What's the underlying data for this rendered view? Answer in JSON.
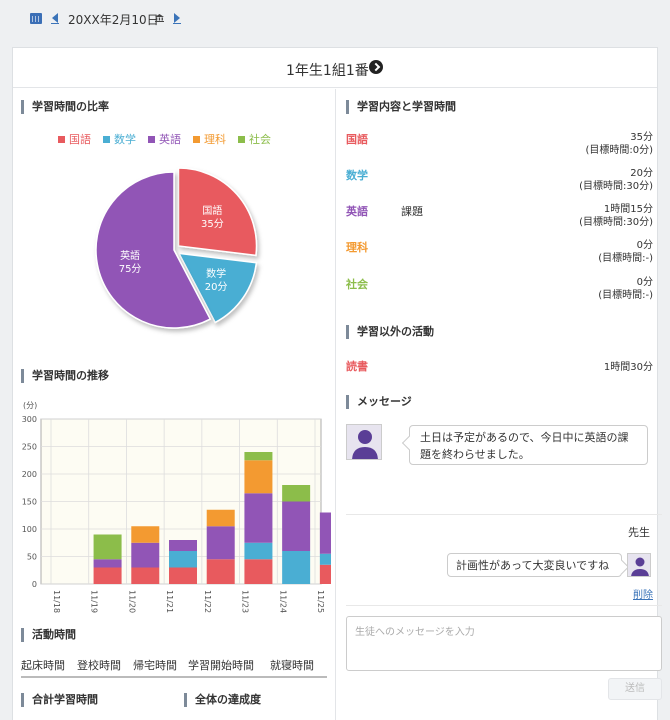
{
  "nav": {
    "date": "20XX年2月10日",
    "cal_icon": "calendar-icon",
    "prev_icon": "caret-left-icon",
    "next_icon": "caret-right-icon",
    "date_icon": "bank-icon"
  },
  "student": {
    "name": "1年生1組1番"
  },
  "colors": {
    "japanese": "#e85a5e",
    "math": "#4aaed3",
    "english": "#9155b6",
    "science": "#f39a31",
    "social": "#8cbd4a",
    "accent": "#3b74b9",
    "section_bar": "#7d8a99"
  },
  "ratio_section": {
    "title": "学習時間の比率",
    "legend": [
      "国語",
      "数学",
      "英語",
      "理科",
      "社会"
    ],
    "pie": [
      {
        "subject": "国語",
        "label": "35分",
        "value": 35,
        "color": "#e85a5e"
      },
      {
        "subject": "数学",
        "label": "20分",
        "value": 20,
        "color": "#4aaed3"
      },
      {
        "subject": "英語",
        "label": "75分",
        "value": 75,
        "color": "#9155b6"
      }
    ]
  },
  "trend_section": {
    "title": "学習時間の推移",
    "unit": "(分)"
  },
  "chart_data": {
    "type": "bar",
    "stacked": true,
    "categories": [
      "11/18",
      "11/19",
      "11/20",
      "11/21",
      "11/22",
      "11/23",
      "11/24",
      "11/25"
    ],
    "ylim": [
      0,
      300
    ],
    "yticks": [
      0,
      50,
      100,
      150,
      200,
      250,
      300
    ],
    "ylabel": "(分)",
    "grid": true,
    "series": [
      {
        "name": "国語",
        "color": "#e85a5e",
        "values": [
          0,
          30,
          30,
          30,
          45,
          45,
          0,
          35
        ]
      },
      {
        "name": "数学",
        "color": "#4aaed3",
        "values": [
          0,
          0,
          0,
          30,
          0,
          30,
          60,
          20
        ]
      },
      {
        "name": "英語",
        "color": "#9155b6",
        "values": [
          0,
          15,
          45,
          20,
          60,
          90,
          90,
          75
        ]
      },
      {
        "name": "理科",
        "color": "#f39a31",
        "values": [
          0,
          0,
          30,
          0,
          30,
          60,
          0,
          0
        ]
      },
      {
        "name": "社会",
        "color": "#8cbd4a",
        "values": [
          0,
          45,
          0,
          0,
          0,
          15,
          30,
          0
        ]
      }
    ]
  },
  "activity_section": {
    "title": "活動時間",
    "columns": [
      "起床時間",
      "登校時間",
      "帰宅時間",
      "学習開始時間",
      "就寝時間"
    ]
  },
  "total_section": {
    "title": "合計学習時間"
  },
  "achieve_section": {
    "title": "全体の達成度"
  },
  "content_section": {
    "title": "学習内容と学習時間",
    "rows": [
      {
        "subject": "国語",
        "task": "",
        "time": "35分",
        "goal": "(目標時間:0分)",
        "color": "#e85a5e"
      },
      {
        "subject": "数学",
        "task": "",
        "time": "20分",
        "goal": "(目標時間:30分)",
        "color": "#4aaed3"
      },
      {
        "subject": "英語",
        "task": "課題",
        "time": "1時間15分",
        "goal": "(目標時間:30分)",
        "color": "#9155b6"
      },
      {
        "subject": "理科",
        "task": "",
        "time": "0分",
        "goal": "(目標時間:-)",
        "color": "#f39a31"
      },
      {
        "subject": "社会",
        "task": "",
        "time": "0分",
        "goal": "(目標時間:-)",
        "color": "#8cbd4a"
      }
    ]
  },
  "other_section": {
    "title": "学習以外の活動",
    "rows": [
      {
        "name": "読書",
        "time": "1時間30分",
        "color": "#e85a5e"
      }
    ]
  },
  "message_section": {
    "title": "メッセージ",
    "student_message": "土日は予定があるので、今日中に英語の課題を終わらせました。",
    "teacher_label": "先生",
    "teacher_message": "計画性があって大変良いですね",
    "delete_label": "削除",
    "input_placeholder": "生徒へのメッセージを入力",
    "send_label": "送信",
    "avatar_icon": "person-icon"
  }
}
